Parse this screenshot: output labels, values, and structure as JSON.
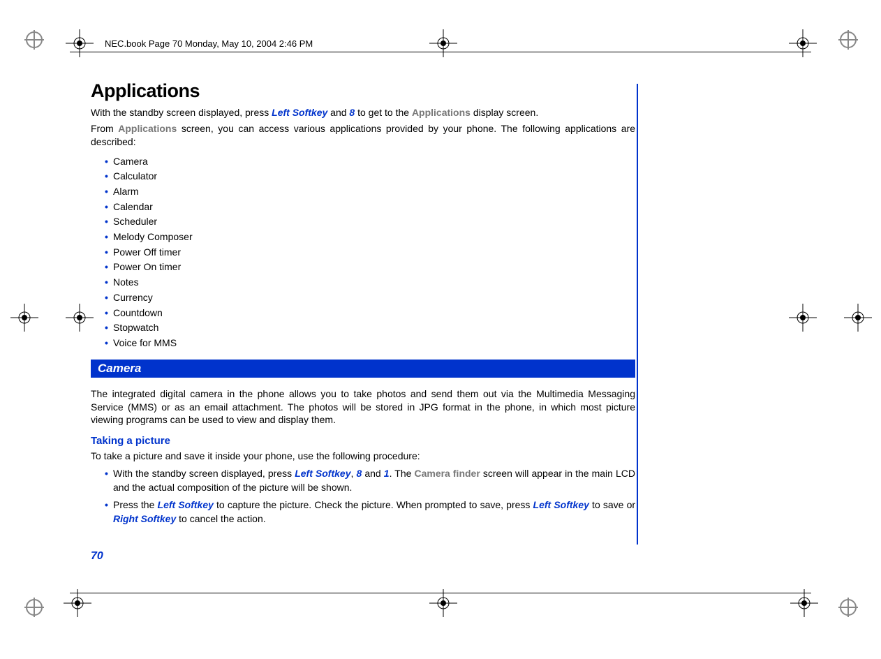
{
  "header": "NEC.book  Page 70  Monday, May 10, 2004  2:46 PM",
  "title": "Applications",
  "intro1_prefix": "With the standby screen displayed, press ",
  "intro1_key1": "Left Softkey",
  "intro1_mid": " and ",
  "intro1_key2": "8",
  "intro1_mid2": " to get to the ",
  "intro1_screen": "Applications",
  "intro1_suffix": " display screen.",
  "intro2_prefix": "From ",
  "intro2_screen": "Applications",
  "intro2_suffix": " screen, you can access various applications provided by your phone. The following applications are described:",
  "apps": [
    "Camera",
    "Calculator",
    "Alarm",
    "Calendar",
    "Scheduler",
    "Melody Composer",
    "Power Off timer",
    "Power On timer",
    "Notes",
    "Currency",
    "Countdown",
    "Stopwatch",
    "Voice for MMS"
  ],
  "section_camera": "Camera",
  "camera_body": "The integrated digital camera in the phone allows you to take photos and send them out via the Multimedia Messaging Service (MMS) or as an email attachment. The photos will be stored in JPG format in the phone, in which most picture viewing programs can be used to view and display them.",
  "sub_taking": "Taking a picture",
  "taking_intro": "To take a picture and save it inside your phone, use the following procedure:",
  "proc1_prefix": "With the standby screen displayed, press ",
  "proc1_k1": "Left Softkey",
  "proc1_c1": ", ",
  "proc1_k2": "8",
  "proc1_c2": " and ",
  "proc1_k3": "1",
  "proc1_c3": ". The ",
  "proc1_screen": "Camera finder",
  "proc1_suffix": " screen will appear in the main LCD and the actual composition of the picture will be shown.",
  "proc2_prefix": "Press the ",
  "proc2_k1": "Left Softkey",
  "proc2_mid1": " to capture the picture. Check the picture. When prompted to save, press ",
  "proc2_k2": "Left Softkey",
  "proc2_mid2": " to save or ",
  "proc2_k3": "Right Softkey",
  "proc2_suffix": " to cancel the action.",
  "page_number": "70"
}
